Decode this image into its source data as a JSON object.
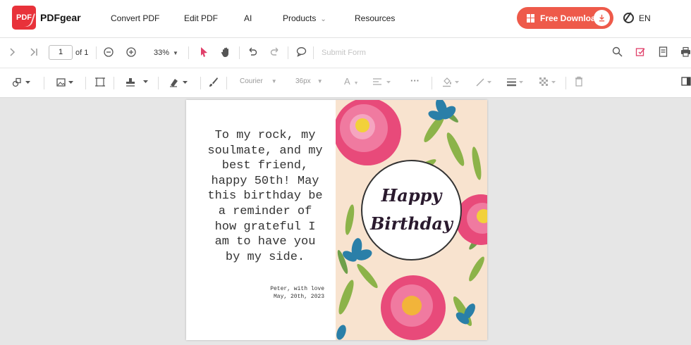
{
  "brand": {
    "logo_mark": "PDF",
    "name": "PDFgear"
  },
  "nav": {
    "items": [
      "Convert PDF",
      "Edit PDF",
      "AI",
      "Products",
      "Resources"
    ],
    "products_chevron": "⌄",
    "download_label": "Free Download",
    "lang_label": "EN"
  },
  "toolbar": {
    "page_current": "1",
    "page_total_label": "of 1",
    "zoom_value": "33%",
    "submit_form_label": "Submit Form"
  },
  "format_bar": {
    "font_family": "Courier",
    "font_size": "36px",
    "text_color_glyph": "A",
    "more_glyph": "···"
  },
  "document": {
    "message_lines": [
      "To my rock, my",
      "soulmate, and my",
      "best friend,",
      "happy 50th! May",
      "this birthday be",
      "a reminder of",
      "how grateful I",
      "am to have you",
      "by my side."
    ],
    "signature_lines": [
      "Peter, with love",
      "May, 20th, 2023"
    ],
    "card_title_line1": "Happy",
    "card_title_line2": "Birthday"
  },
  "colors": {
    "accent": "#ee5a4a",
    "logo": "#e8323a",
    "pink_icon": "#e0406a",
    "card_background": "#f8e3cf"
  }
}
